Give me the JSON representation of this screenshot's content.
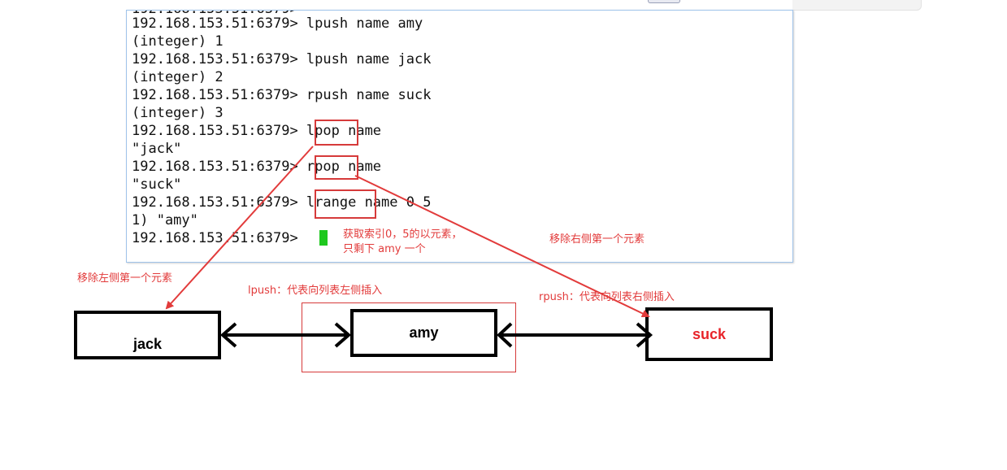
{
  "terminal": {
    "prompt": "192.168.153.51:6379>",
    "lines": [
      "192.168.153.51:6379> lpush name amy",
      "(integer) 1",
      "192.168.153.51:6379> lpush name jack",
      "(integer) 2",
      "192.168.153.51:6379> rpush name suck",
      "(integer) 3",
      "192.168.153.51:6379> lpop name",
      "\"jack\"",
      "192.168.153.51:6379> rpop name",
      "\"suck\"",
      "192.168.153.51:6379> lrange name 0 5",
      "1) \"amy\"",
      "192.168.153.51:6379> "
    ],
    "highlighted_commands": [
      "lpop",
      "rpop",
      "lrange"
    ]
  },
  "annotations": {
    "lrange_note": [
      "获取索引0，5的以元素，",
      "只剩下 amy 一个"
    ],
    "rpop_note": "移除右侧第一个元素",
    "lpop_note": "移除左侧第一个元素",
    "lpush_note": "lpush：代表向列表左侧插入",
    "rpush_note": "rpush：代表向列表右侧插入"
  },
  "diagram": {
    "nodes": [
      "jack",
      "amy",
      "suck"
    ],
    "colors": {
      "accent": "#e23b3b",
      "suck_text": "#e8242a",
      "cursor": "#1ec81e",
      "border": "#000000"
    }
  }
}
